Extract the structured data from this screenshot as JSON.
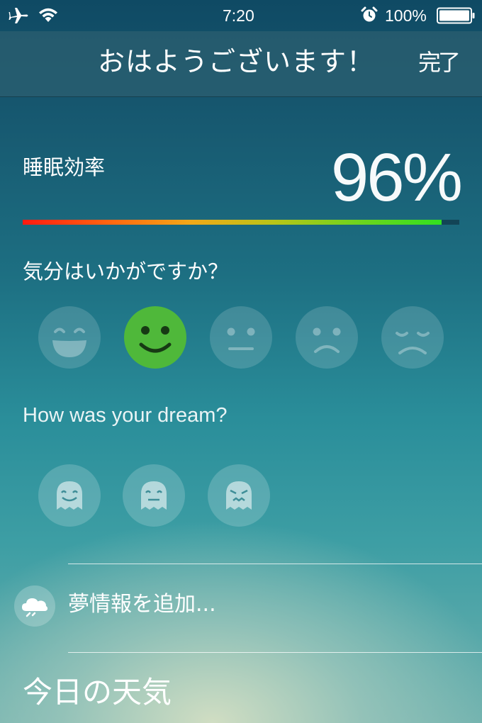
{
  "status_bar": {
    "time": "7:20",
    "battery": "100%",
    "icons": [
      "airplane-icon",
      "wifi-icon",
      "alarm-icon",
      "battery-icon"
    ]
  },
  "header": {
    "title": "おはようございます！",
    "done_label": "完了"
  },
  "sleep_efficiency": {
    "label": "睡眠効率",
    "value": "96%",
    "fraction": 0.96
  },
  "mood": {
    "question": "気分はいかがですか？",
    "options": [
      "very-happy",
      "happy",
      "neutral",
      "sad",
      "very-sad"
    ],
    "selected": "happy",
    "selected_color": "#4fb83a"
  },
  "dream": {
    "question": "How was your dream?",
    "options": [
      "good-dream",
      "neutral-dream",
      "bad-dream"
    ]
  },
  "add_dream": {
    "label": "夢情報を追加...",
    "icon": "cloud-icon"
  },
  "weather": {
    "title": "今日の天気"
  }
}
